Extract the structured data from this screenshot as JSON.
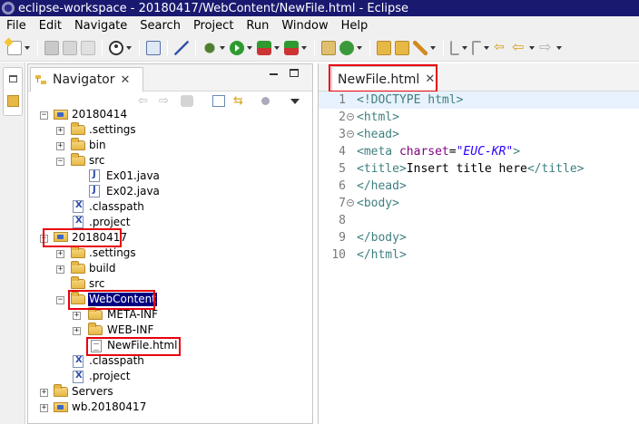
{
  "window": {
    "title": "eclipse-workspace - 20180417/WebContent/NewFile.html - Eclipse"
  },
  "menu": [
    "File",
    "Edit",
    "Navigate",
    "Search",
    "Project",
    "Run",
    "Window",
    "Help"
  ],
  "navigator": {
    "tab_label": "Navigator",
    "tree": [
      {
        "label": "20180414",
        "type": "project",
        "toggle": "−"
      },
      {
        "label": ".settings",
        "type": "folder",
        "toggle": "+"
      },
      {
        "label": "bin",
        "type": "folder",
        "toggle": "+"
      },
      {
        "label": "src",
        "type": "folder",
        "toggle": "−"
      },
      {
        "label": "Ex01.java",
        "type": "java"
      },
      {
        "label": "Ex02.java",
        "type": "java"
      },
      {
        "label": ".classpath",
        "type": "xml"
      },
      {
        "label": ".project",
        "type": "xml"
      },
      {
        "label": "20180417",
        "type": "project",
        "toggle": "−"
      },
      {
        "label": ".settings",
        "type": "folder",
        "toggle": "+"
      },
      {
        "label": "build",
        "type": "folder",
        "toggle": "+"
      },
      {
        "label": "src",
        "type": "folder"
      },
      {
        "label": "WebContent",
        "type": "folder",
        "toggle": "−",
        "selected": true
      },
      {
        "label": "META-INF",
        "type": "folder",
        "toggle": "+"
      },
      {
        "label": "WEB-INF",
        "type": "folder",
        "toggle": "+"
      },
      {
        "label": "NewFile.html",
        "type": "html"
      },
      {
        "label": ".classpath",
        "type": "xml"
      },
      {
        "label": ".project",
        "type": "xml"
      },
      {
        "label": "Servers",
        "type": "folder",
        "toggle": "+"
      },
      {
        "label": "wb.20180417",
        "type": "project",
        "toggle": "+"
      }
    ]
  },
  "editor": {
    "tab_label": "NewFile.html",
    "lines": [
      {
        "num": "1",
        "fold": false
      },
      {
        "num": "2",
        "fold": true
      },
      {
        "num": "3",
        "fold": true
      },
      {
        "num": "4",
        "fold": false
      },
      {
        "num": "5",
        "fold": false
      },
      {
        "num": "6",
        "fold": false
      },
      {
        "num": "7",
        "fold": true
      },
      {
        "num": "8",
        "fold": false
      },
      {
        "num": "9",
        "fold": false
      },
      {
        "num": "10",
        "fold": false
      }
    ],
    "code": {
      "l1_open": "<!",
      "l1_doctype": "DOCTYPE html",
      "l1_close": ">",
      "l2": "<html>",
      "l3": "<head>",
      "l4_open": "<",
      "l4_tag": "meta",
      "l4_attr": "charset",
      "l4_eq": "=",
      "l4_val": "\"EUC-KR\"",
      "l4_close": ">",
      "l5_open": "<title>",
      "l5_text": "Insert title here",
      "l5_close": "</title>",
      "l6": "</head>",
      "l7": "<body>",
      "l9": "</body>",
      "l10": "</html>"
    }
  },
  "colors": {
    "highlight": "#e8000c",
    "selection": "#000080",
    "title_bar": "#191970"
  }
}
